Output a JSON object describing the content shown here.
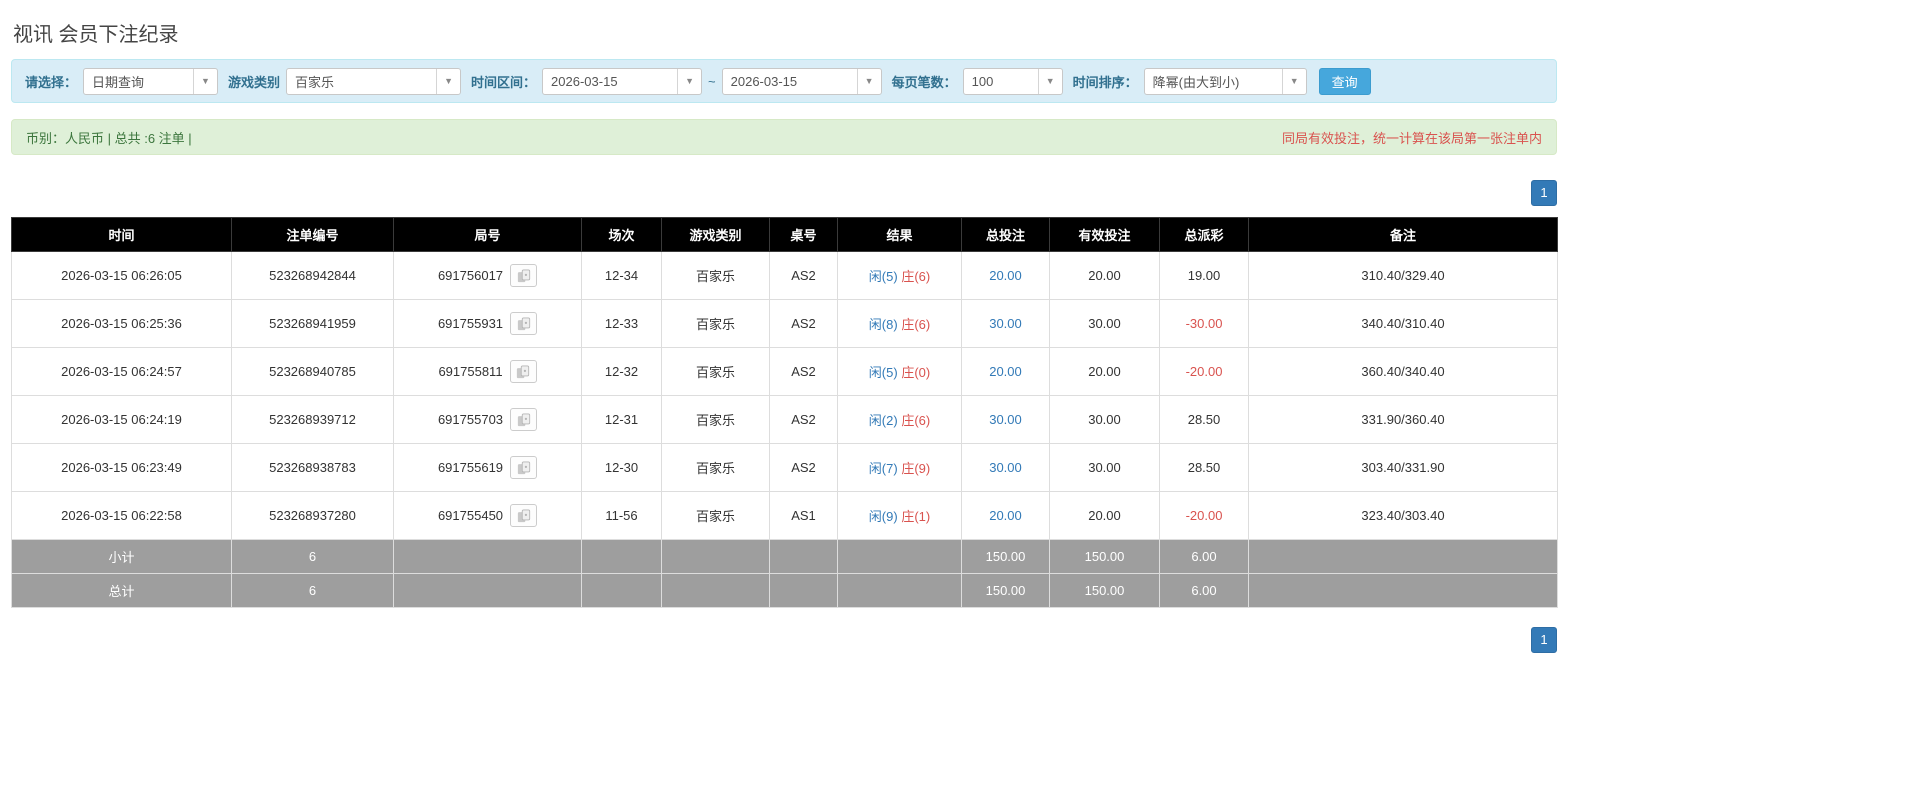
{
  "page": {
    "title": "视讯 会员下注纪录"
  },
  "colors": {
    "filter_bar_bg": "#d9edf7",
    "summary_bar_bg": "#dff0d8",
    "accent_blue": "#337ab7",
    "button_blue": "#46a7dc",
    "negative_red": "#d9534f",
    "player_blue": "#337ab7",
    "banker_red": "#d9534f",
    "table_header_bg": "#000000",
    "summary_row_bg": "#9e9e9e"
  },
  "filters": {
    "select_label": "请选择：",
    "select_value": "日期查询",
    "game_type_label": "游戏类别",
    "game_type_value": "百家乐",
    "time_range_label": "时间区间：",
    "date_from": "2026-03-15",
    "date_separator": "~",
    "date_to": "2026-03-15",
    "page_size_label": "每页笔数：",
    "page_size_value": "100",
    "sort_label": "时间排序：",
    "sort_value": "降幂(由大到小)",
    "search_button": "查询",
    "caret": "▼"
  },
  "summary": {
    "left": "币别：人民币 | 总共 :6 注单 |",
    "right": "同局有效投注，统一计算在该局第一张注单内"
  },
  "pagination": {
    "page": "1"
  },
  "table": {
    "headers": [
      "时间",
      "注单编号",
      "局号",
      "场次",
      "游戏类别",
      "桌号",
      "结果",
      "总投注",
      "有效投注",
      "总派彩",
      "备注"
    ],
    "rows": [
      {
        "time": "2026-03-15 06:26:05",
        "bet_id": "523268942844",
        "round_id": "691756017",
        "session": "12-34",
        "game": "百家乐",
        "table_no": "AS2",
        "result_player": "闲(5)",
        "result_banker": "庄(6)",
        "total_bet": "20.00",
        "valid_bet": "20.00",
        "payout": "19.00",
        "remark": "310.40/329.40"
      },
      {
        "time": "2026-03-15 06:25:36",
        "bet_id": "523268941959",
        "round_id": "691755931",
        "session": "12-33",
        "game": "百家乐",
        "table_no": "AS2",
        "result_player": "闲(8)",
        "result_banker": "庄(6)",
        "total_bet": "30.00",
        "valid_bet": "30.00",
        "payout": "-30.00",
        "remark": "340.40/310.40"
      },
      {
        "time": "2026-03-15 06:24:57",
        "bet_id": "523268940785",
        "round_id": "691755811",
        "session": "12-32",
        "game": "百家乐",
        "table_no": "AS2",
        "result_player": "闲(5)",
        "result_banker": "庄(0)",
        "total_bet": "20.00",
        "valid_bet": "20.00",
        "payout": "-20.00",
        "remark": "360.40/340.40"
      },
      {
        "time": "2026-03-15 06:24:19",
        "bet_id": "523268939712",
        "round_id": "691755703",
        "session": "12-31",
        "game": "百家乐",
        "table_no": "AS2",
        "result_player": "闲(2)",
        "result_banker": "庄(6)",
        "total_bet": "30.00",
        "valid_bet": "30.00",
        "payout": "28.50",
        "remark": "331.90/360.40"
      },
      {
        "time": "2026-03-15 06:23:49",
        "bet_id": "523268938783",
        "round_id": "691755619",
        "session": "12-30",
        "game": "百家乐",
        "table_no": "AS2",
        "result_player": "闲(7)",
        "result_banker": "庄(9)",
        "total_bet": "30.00",
        "valid_bet": "30.00",
        "payout": "28.50",
        "remark": "303.40/331.90"
      },
      {
        "time": "2026-03-15 06:22:58",
        "bet_id": "523268937280",
        "round_id": "691755450",
        "session": "11-56",
        "game": "百家乐",
        "table_no": "AS1",
        "result_player": "闲(9)",
        "result_banker": "庄(1)",
        "total_bet": "20.00",
        "valid_bet": "20.00",
        "payout": "-20.00",
        "remark": "323.40/303.40"
      }
    ],
    "subtotal": {
      "label": "小计",
      "count": "6",
      "total_bet": "150.00",
      "valid_bet": "150.00",
      "payout": "6.00"
    },
    "total": {
      "label": "总计",
      "count": "6",
      "total_bet": "150.00",
      "valid_bet": "150.00",
      "payout": "6.00"
    }
  }
}
